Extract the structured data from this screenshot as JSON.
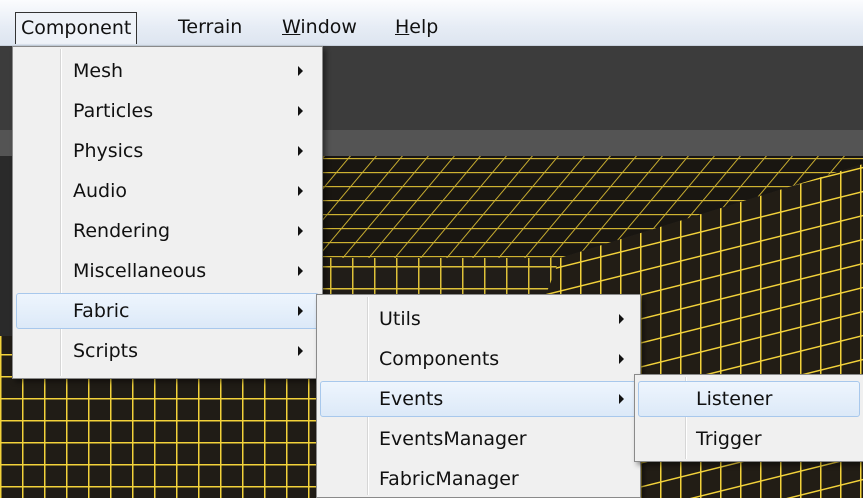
{
  "menubar": {
    "items": [
      {
        "label": "Component",
        "open": true
      },
      {
        "label": "Terrain"
      },
      {
        "label": "Window"
      },
      {
        "label": "Help"
      }
    ]
  },
  "component_menu": {
    "items": [
      {
        "label": "Mesh",
        "submenu": true
      },
      {
        "label": "Particles",
        "submenu": true
      },
      {
        "label": "Physics",
        "submenu": true
      },
      {
        "label": "Audio",
        "submenu": true
      },
      {
        "label": "Rendering",
        "submenu": true
      },
      {
        "label": "Miscellaneous",
        "submenu": true
      },
      {
        "label": "Fabric",
        "submenu": true,
        "highlighted": true
      },
      {
        "label": "Scripts",
        "submenu": true
      }
    ]
  },
  "fabric_menu": {
    "items": [
      {
        "label": "Utils",
        "submenu": true
      },
      {
        "label": "Components",
        "submenu": true
      },
      {
        "label": "Events",
        "submenu": true,
        "highlighted": true
      },
      {
        "label": "EventsManager"
      },
      {
        "label": "FabricManager"
      }
    ]
  },
  "events_menu": {
    "items": [
      {
        "label": "Listener",
        "highlighted": true
      },
      {
        "label": "Trigger"
      }
    ]
  },
  "colors": {
    "grid_line": "#f2d23a",
    "grid_background": "#201c16",
    "menu_background": "#f0f0f0",
    "highlight_border": "#a8c8ec"
  }
}
